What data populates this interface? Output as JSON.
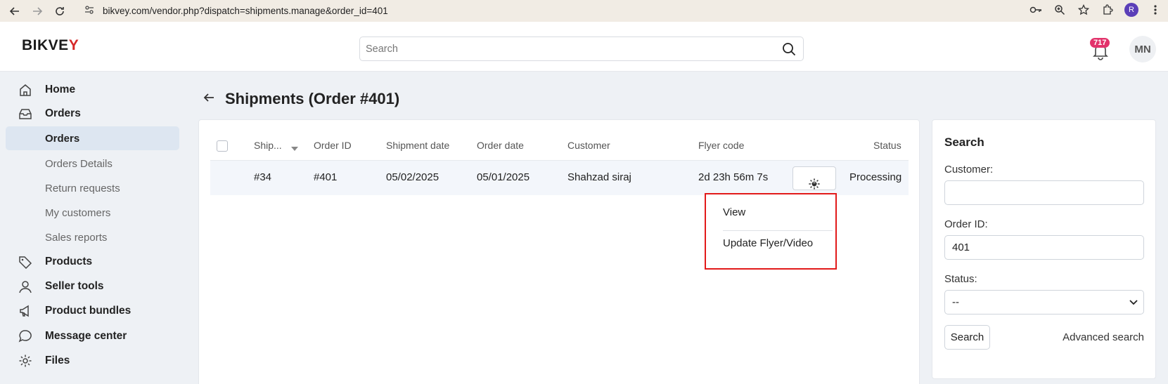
{
  "browser": {
    "url": "bikvey.com/vendor.php?dispatch=shipments.manage&order_id=401",
    "profile_initial": "R"
  },
  "header": {
    "logo_text_main": "BIKVE",
    "logo_text_accent": "Y",
    "search_placeholder": "Search",
    "notification_count": "717",
    "user_initials": "MN"
  },
  "sidebar": {
    "items": [
      {
        "label": "Home",
        "icon": "home-icon"
      },
      {
        "label": "Orders",
        "icon": "inbox-icon"
      },
      {
        "label": "Products",
        "icon": "tag-icon"
      },
      {
        "label": "Seller tools",
        "icon": "user-icon"
      },
      {
        "label": "Product bundles",
        "icon": "megaphone-icon"
      },
      {
        "label": "Message center",
        "icon": "chat-icon"
      },
      {
        "label": "Files",
        "icon": "gear-icon"
      }
    ],
    "orders_sub": [
      {
        "label": "Orders",
        "active": true
      },
      {
        "label": "Orders Details"
      },
      {
        "label": "Return requests"
      },
      {
        "label": "My customers"
      },
      {
        "label": "Sales reports"
      }
    ]
  },
  "page": {
    "title": "Shipments (Order #401)"
  },
  "table": {
    "columns": [
      "Ship...",
      "Order ID",
      "Shipment date",
      "Order date",
      "Customer",
      "Flyer code",
      "Status"
    ],
    "rows": [
      {
        "shipment": "#34",
        "order_id": "#401",
        "shipment_date": "05/02/2025",
        "order_date": "05/01/2025",
        "customer": "Shahzad siraj",
        "flyer_code": "2d 23h 56m 7s",
        "status": "Processing"
      }
    ]
  },
  "dropdown_menu": {
    "items": [
      "View",
      "Update Flyer/Video"
    ],
    "highlight_color": "#e21a1a"
  },
  "search_panel": {
    "title": "Search",
    "customer_label": "Customer:",
    "customer_value": "",
    "order_id_label": "Order ID:",
    "order_id_value": "401",
    "status_label": "Status:",
    "status_value": "--",
    "search_button": "Search",
    "advanced_link": "Advanced search"
  },
  "colors": {
    "accent": "#d62828",
    "badge": "#e2336b",
    "sidebar_active": "#dde6f1"
  }
}
